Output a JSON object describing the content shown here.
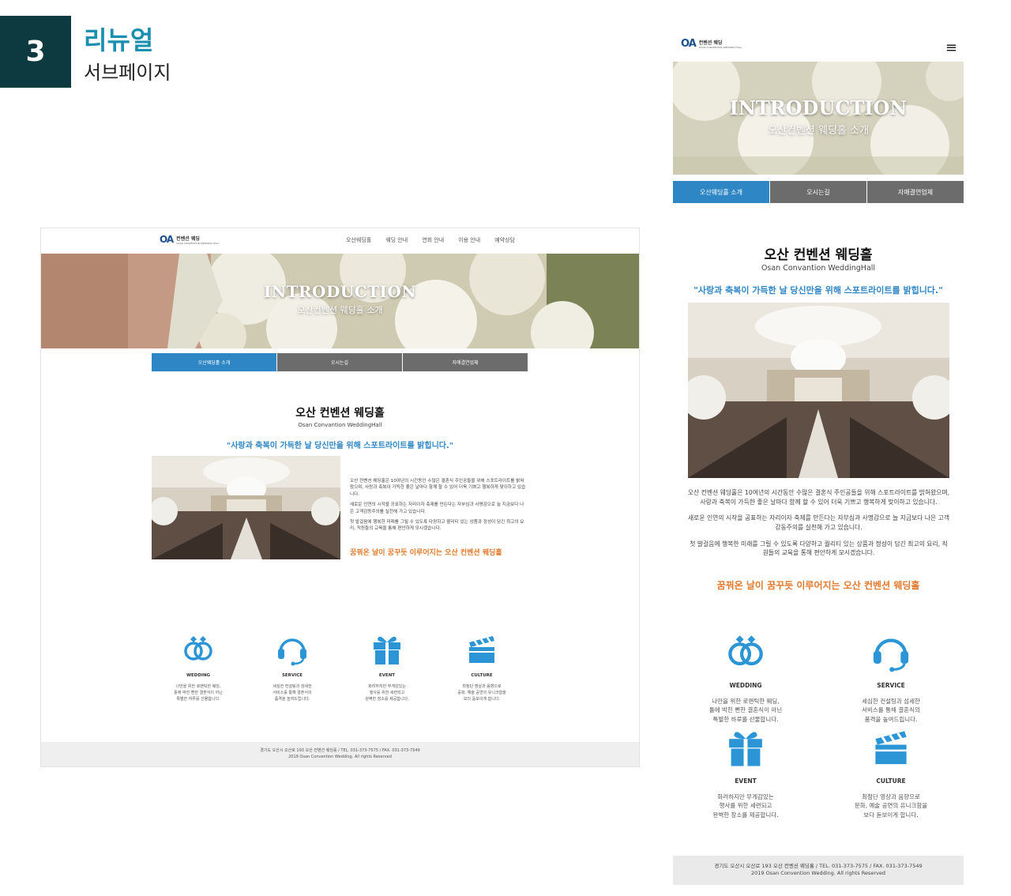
{
  "header": {
    "number": "3",
    "title": "리뉴얼",
    "subtitle": "서브페이지"
  },
  "colors": {
    "accent_blue": "#2e86c4",
    "accent_orange": "#e07a2f",
    "tab_gray": "#6c6c6c",
    "dark_teal": "#0d3a40",
    "title_blue": "#1b8fb0"
  },
  "desktop": {
    "logo": {
      "mark": "OA",
      "text": "컨벤션 웨딩",
      "sub": "OSAN CONVENTION WEDDING HALL"
    },
    "nav": [
      "오산웨딩홀",
      "웨딩 안내",
      "연회 안내",
      "이용 안내",
      "예약상담"
    ],
    "hero": {
      "title": "INTRODUCTION",
      "subtitle": "오산컨벤션 웨딩홀 소개"
    },
    "tabs": [
      "오산웨딩홀 소개",
      "오시는길",
      "자매결연업체"
    ],
    "heading": "오산 컨벤션 웨딩홀",
    "heading_en": "Osan Convantion WeddingHall",
    "quote": "\"사랑과 축복이 가득한 날 당신만을 위해 스포트라이트를 밝힙니다.\"",
    "paragraphs": [
      "오산 컨벤션 웨딩홀은 10여년의 시간동안 수많은 결혼식 주인공들을 위해 스포트라이트를 밝혀왔으며, 사랑과 축복이 가득한 좋은 날마다 함께 할 수 있어 더욱 기쁘고 행복하게 맞이하고 있습니다.",
      "새로운 인연의 시작을 공표하는 자리이자 축제를 만든다는 자부심과 사명감으로 늘 지금보다 나은 고객감동주의를 실천해 가고 있습니다.",
      "첫 발걸음에 행복한 미래를 그릴 수 있도록 다양하고 퀄리티 있는 상품과 정성이 담긴 최고의 요리, 직원들의 교육을 통해 편안하게 모시겠습니다."
    ],
    "accent": "꿈꿔온 날이 꿈꾸듯 이루어지는 오산 컨벤션 웨딩홀",
    "features": [
      {
        "icon": "rings-icon",
        "title": "WEDDING",
        "desc": [
          "나만을 위한 로맨틱한 웨딩,",
          "틀에 박힌 뻔한 결혼식이 아닌",
          "특별한 하루를 선물합니다."
        ]
      },
      {
        "icon": "headset-icon",
        "title": "SERVICE",
        "desc": [
          "세심한 컨설팅과 섬세한",
          "서비스를 통해 결혼식의",
          "품격을 높여드립니다."
        ]
      },
      {
        "icon": "gift-icon",
        "title": "EVENT",
        "desc": [
          "화려하지만 무게감있는",
          "행사를 위한 세련되고",
          "완벽한 장소를 제공합니다."
        ]
      },
      {
        "icon": "clapperboard-icon",
        "title": "CULTURE",
        "desc": [
          "최첨단 영상과 음향으로",
          "공화, 예술 공연의 유니크함을",
          "보다 돋보이게 합니다."
        ]
      }
    ],
    "footer": {
      "line1": "경기도 오산시 오산로 193 오산 컨벤션 웨딩홀 / TEL. 031-373-7575 / FAX. 031-373-7549",
      "line2": "2019 Osan Convention Wedding. All rights Reserved"
    }
  },
  "mobile": {
    "logo": {
      "mark": "OA",
      "text": "컨벤션 웨딩",
      "sub": "OSAN CONVENTION WEDDING HALL"
    },
    "menu_glyph": "≡",
    "hero": {
      "title": "INTRODUCTION",
      "subtitle": "오산컨벤션 웨딩홀 소개"
    },
    "tabs": [
      "오산웨딩홀 소개",
      "오시는길",
      "자매결연업체"
    ],
    "heading": "오산 컨벤션 웨딩홀",
    "heading_en": "Osan Convantion WeddingHall",
    "quote": "\"사랑과 축복이 가득한 날 당신만을 위해 스포트라이트를 밝힙니다.\"",
    "paragraphs": [
      "오산 컨벤션 웨딩홀은 10여년의 시간동안 수많은 결혼식 주인공들을 위해 스포트라이트를 밝혀왔으며, 사랑과 축복이 가득한 좋은 날마다 함께 할 수 있어 더욱 기쁘고 행복하게 맞이하고 있습니다.",
      "새로운 인연의 시작을 공표하는 자리이자 축제를 만든다는 자부심과 사명감으로 늘 지금보다 나은 고객감동주의를 실천해 가고 있습니다.",
      "첫 발걸음에 행복한 미래를 그릴 수 있도록 다양하고 퀄리티 있는 상품과 정성이 담긴 최고의 요리, 직원들의 교육을 통해 편안하게 모시겠습니다."
    ],
    "accent": "꿈꿔온 날이 꿈꾸듯 이루어지는 오산 컨벤션 웨딩홀",
    "features": [
      {
        "icon": "rings-icon",
        "title": "WEDDING",
        "desc": [
          "나만을 위한 로맨틱한 웨딩,",
          "틀에 박힌 뻔한 결혼식이 아닌",
          "특별한 하루를 선물합니다."
        ]
      },
      {
        "icon": "headset-icon",
        "title": "SERVICE",
        "desc": [
          "세심한 컨설팅과 섬세한",
          "서비스를 통해 결혼식의",
          "품격을 높여드립니다."
        ]
      },
      {
        "icon": "gift-icon",
        "title": "EVENT",
        "desc": [
          "화려하지만 무게감있는",
          "행사를 위한 세련되고",
          "완벽한 장소를 제공합니다."
        ]
      },
      {
        "icon": "clapperboard-icon",
        "title": "CULTURE",
        "desc": [
          "최첨단 영상과 음향으로",
          "문화, 예술 공연의 유니크함을",
          "보다 돋보이게 합니다."
        ]
      }
    ],
    "footer": {
      "line1": "경기도 오산시 오산로 193 오산 컨벤션 웨딩홀 / TEL. 031-373-7575 / FAX. 031-373-7549",
      "line2": "2019 Osan Convention Wedding. All rights Reserved"
    }
  }
}
